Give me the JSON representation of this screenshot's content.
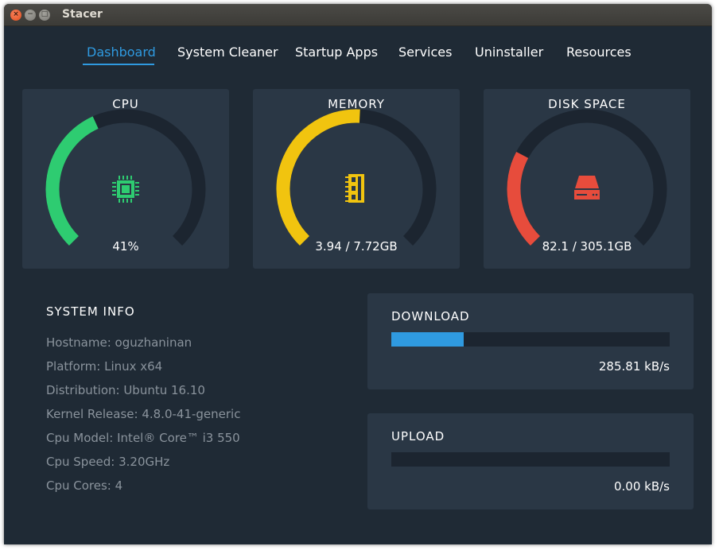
{
  "window": {
    "title": "Stacer"
  },
  "tabs": [
    {
      "label": "Dashboard",
      "active": true
    },
    {
      "label": "System Cleaner",
      "active": false
    },
    {
      "label": "Startup Apps",
      "active": false
    },
    {
      "label": "Services",
      "active": false
    },
    {
      "label": "Uninstaller",
      "active": false
    },
    {
      "label": "Resources",
      "active": false
    }
  ],
  "gauges": [
    {
      "title": "CPU",
      "value_text": "41%",
      "fraction": 0.41,
      "color": "#2ecc71",
      "icon": "cpu-chip-icon"
    },
    {
      "title": "MEMORY",
      "value_text": "3.94 / 7.72GB",
      "fraction": 0.51,
      "color": "#f1c40f",
      "icon": "memory-module-icon"
    },
    {
      "title": "DISK SPACE",
      "value_text": "82.1 / 305.1GB",
      "fraction": 0.27,
      "color": "#e74c3c",
      "icon": "hard-disk-icon"
    }
  ],
  "gauge_track_color": "#1c2530",
  "system_info": {
    "title": "SYSTEM INFO",
    "lines": [
      "Hostname: oguzhaninan",
      "Platform: Linux x64",
      "Distribution: Ubuntu 16.10",
      "Kernel Release: 4.8.0-41-generic",
      "Cpu Model: Intel® Core™ i3 550",
      "Cpu Speed: 3.20GHz",
      "Cpu Cores: 4"
    ]
  },
  "network": {
    "download": {
      "title": "DOWNLOAD",
      "value_text": "285.81 kB/s",
      "fraction": 0.26
    },
    "upload": {
      "title": "UPLOAD",
      "value_text": "0.00 kB/s",
      "fraction": 0.0
    }
  },
  "accent_color": "#2f9ae0"
}
